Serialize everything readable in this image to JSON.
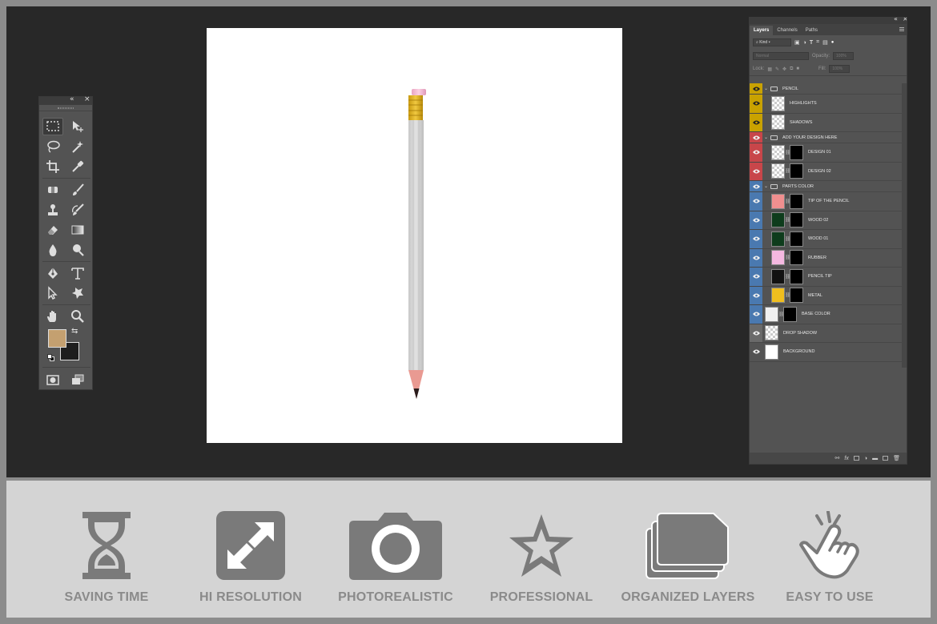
{
  "layers_panel": {
    "tabs": [
      "Layers",
      "Channels",
      "Paths"
    ],
    "filter_kind": "Kind",
    "blend_mode": "Normal",
    "opacity_label": "Opacity:",
    "opacity_value": "100%",
    "lock_label": "Lock:",
    "fill_label": "Fill:",
    "fill_value": "100%",
    "layers": [
      {
        "name": "PENCIL",
        "type": "group",
        "color": "#c9a200"
      },
      {
        "name": "HIGHLIGHTS",
        "type": "layer",
        "color": "#c9a200"
      },
      {
        "name": "SHADOWS",
        "type": "layer",
        "color": "#c9a200"
      },
      {
        "name": "ADD YOUR DESIGN HERE",
        "type": "group",
        "color": "#c8464a"
      },
      {
        "name": "DESIGN 01",
        "type": "smart",
        "color": "#c8464a"
      },
      {
        "name": "DESIGN 02",
        "type": "smart",
        "color": "#c8464a"
      },
      {
        "name": "PARTS COLOR",
        "type": "group",
        "color": "#4a79b0"
      },
      {
        "name": "TIP OF THE PENCIL",
        "type": "fill",
        "color": "#4a79b0",
        "swatch": "#f08f8f"
      },
      {
        "name": "WOOD 02",
        "type": "fill",
        "color": "#4a79b0",
        "swatch": "#0e3c1c"
      },
      {
        "name": "WOOD 01",
        "type": "fill",
        "color": "#4a79b0",
        "swatch": "#0e3c1c"
      },
      {
        "name": "RUBBER",
        "type": "fill",
        "color": "#4a79b0",
        "swatch": "#f4b8e0"
      },
      {
        "name": "PENCIL TIP",
        "type": "fill",
        "color": "#4a79b0",
        "swatch": "#111111"
      },
      {
        "name": "METAL",
        "type": "fill",
        "color": "#4a79b0",
        "swatch": "#f0be1e"
      },
      {
        "name": "BASE COLOR",
        "type": "fill",
        "color": "#4a79b0",
        "swatch": "#f0f0f0"
      },
      {
        "name": "DROP SHADOW",
        "type": "layer",
        "color": "#6a6a6a"
      },
      {
        "name": "BACKGROUND",
        "type": "fill",
        "color": "#535353",
        "swatch": "#ffffff"
      }
    ]
  },
  "toolbar": {
    "collapse_icon": "«",
    "close_icon": "×",
    "foreground_color": "#c4a070",
    "background_color": "#1e1e1e"
  },
  "features": [
    {
      "label": "SAVING TIME",
      "icon": "hourglass-icon"
    },
    {
      "label": "HI RESOLUTION",
      "icon": "expand-icon"
    },
    {
      "label": "PHOTOREALISTIC",
      "icon": "camera-icon"
    },
    {
      "label": "PROFESSIONAL",
      "icon": "star-icon"
    },
    {
      "label": "ORGANIZED LAYERS",
      "icon": "layers-icon"
    },
    {
      "label": "EASY TO USE",
      "icon": "tap-hand-icon"
    }
  ]
}
